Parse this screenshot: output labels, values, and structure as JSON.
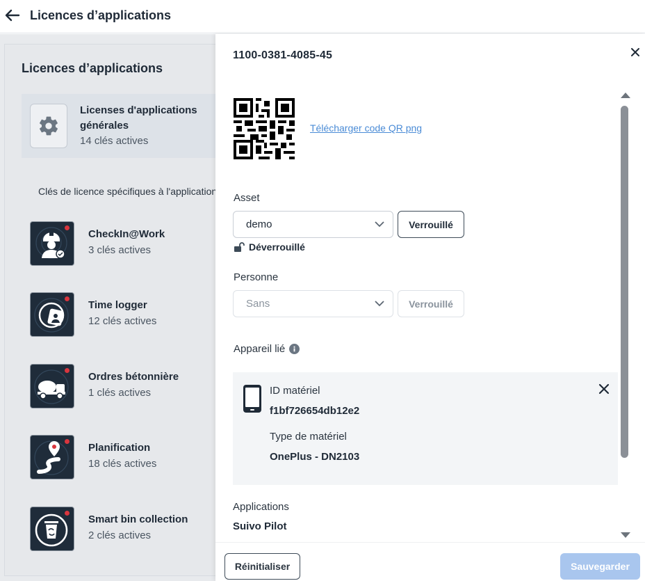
{
  "header": {
    "title": "Licences d’applications"
  },
  "left": {
    "heading": "Licences d’applications",
    "general": {
      "title": "Licenses d'applications générales",
      "subtitle": "14 clés actives"
    },
    "specific_label": "Clés de licence spécifiques à l'application",
    "apps": [
      {
        "name": "CheckIn@Work",
        "subtitle": "3 clés actives",
        "icon": "worker-icon"
      },
      {
        "name": "Time logger",
        "subtitle": "12 clés actives",
        "icon": "time-logger-icon"
      },
      {
        "name": "Ordres bétonnière",
        "subtitle": "1 clés actives",
        "icon": "concrete-mixer-icon"
      },
      {
        "name": "Planification",
        "subtitle": "18 clés actives",
        "icon": "route-pin-icon"
      },
      {
        "name": "Smart bin collection",
        "subtitle": "2 clés actives",
        "icon": "recycle-bin-icon"
      }
    ]
  },
  "drawer": {
    "license_key": "1100-0381-4085-45",
    "qr_download_label": "Télécharger code QR png",
    "asset": {
      "label": "Asset",
      "value": "demo",
      "lock_button": "Verrouillé",
      "status": "Déverrouillé"
    },
    "person": {
      "label": "Personne",
      "value": "Sans",
      "lock_button": "Verrouillé"
    },
    "linked_device": {
      "label": "Appareil lié",
      "hardware_id_label": "ID matériel",
      "hardware_id": "f1bf726654db12e2",
      "hardware_type_label": "Type de matériel",
      "hardware_type": "OnePlus - DN2103"
    },
    "applications": {
      "label": "Applications",
      "value": "Suivo Pilot"
    },
    "reset_button": "Réinitialiser",
    "save_button": "Sauvegarder"
  },
  "colors": {
    "accent": "#4a8bd6",
    "save_disabled": "#a9c6ee",
    "app_icon_bg": "#1f2c3a",
    "badge_red": "#d9363e"
  }
}
